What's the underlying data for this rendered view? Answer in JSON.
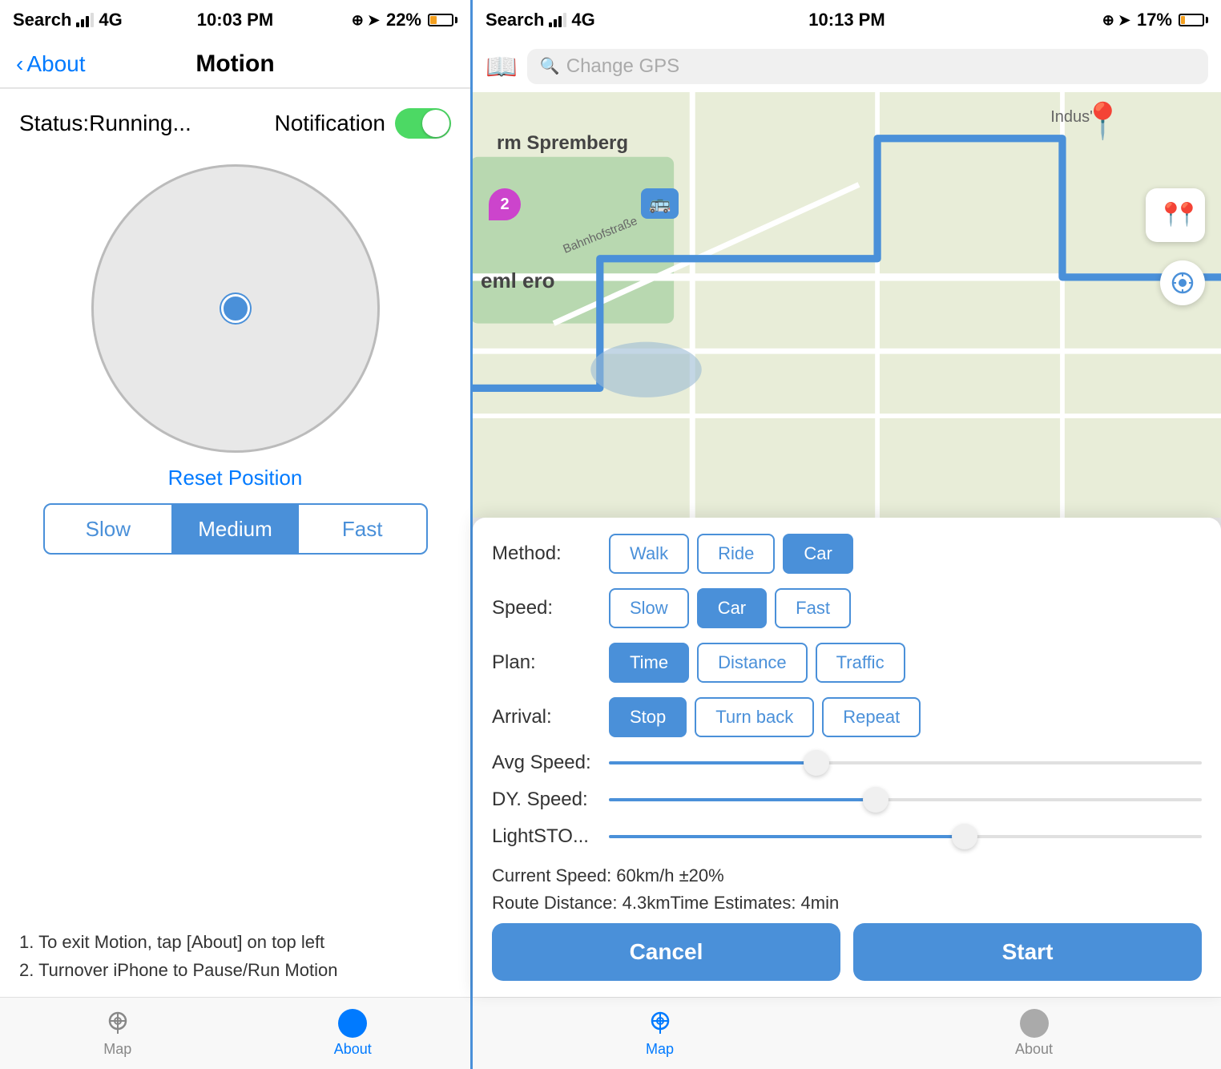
{
  "left": {
    "status_bar": {
      "carrier": "Search",
      "signal": "4G",
      "time": "10:03 PM",
      "battery_pct": "22%"
    },
    "nav": {
      "back_label": "About",
      "title": "Motion"
    },
    "status_label": "Status:Running...",
    "notification_label": "Notification",
    "reset_label": "Reset Position",
    "speed_options": [
      "Slow",
      "Medium",
      "Fast"
    ],
    "speed_active": 1,
    "instructions": [
      "1. To exit Motion, tap [About] on top left",
      "2. Turnover iPhone to Pause/Run Motion"
    ],
    "tabs": [
      {
        "label": "Map",
        "icon": "map-icon",
        "active": false
      },
      {
        "label": "About",
        "icon": "about-icon",
        "active": true
      }
    ]
  },
  "right": {
    "status_bar": {
      "carrier": "Search",
      "signal": "4G",
      "time": "10:13 PM",
      "battery_pct": "17%"
    },
    "search_placeholder": "Change GPS",
    "map": {
      "city1": "rm Spremberg",
      "city2": "eml ero",
      "street": "Bahnhofstraße",
      "indust": "Indus'",
      "number_badge": "2"
    },
    "controls": {
      "method_label": "Method:",
      "method_options": [
        "Walk",
        "Ride",
        "Car"
      ],
      "method_active": 2,
      "speed_label": "Speed:",
      "speed_options": [
        "Slow",
        "Car",
        "Fast"
      ],
      "speed_active": 1,
      "plan_label": "Plan:",
      "plan_options": [
        "Time",
        "Distance",
        "Traffic"
      ],
      "plan_active": 0,
      "arrival_label": "Arrival:",
      "arrival_options": [
        "Stop",
        "Turn back",
        "Repeat"
      ],
      "arrival_active": 0,
      "avg_speed_label": "Avg Speed:",
      "avg_speed_pct": 35,
      "dy_speed_label": "DY. Speed:",
      "dy_speed_pct": 45,
      "light_label": "LightSTO...",
      "light_pct": 60,
      "current_speed": "Current Speed: 60km/h ±20%",
      "route_distance": "Route Distance: 4.3kmTime Estimates:  4min",
      "cancel_label": "Cancel",
      "start_label": "Start"
    },
    "tabs": [
      {
        "label": "Map",
        "icon": "map-icon",
        "active": true
      },
      {
        "label": "About",
        "icon": "about-icon",
        "active": false
      }
    ]
  }
}
